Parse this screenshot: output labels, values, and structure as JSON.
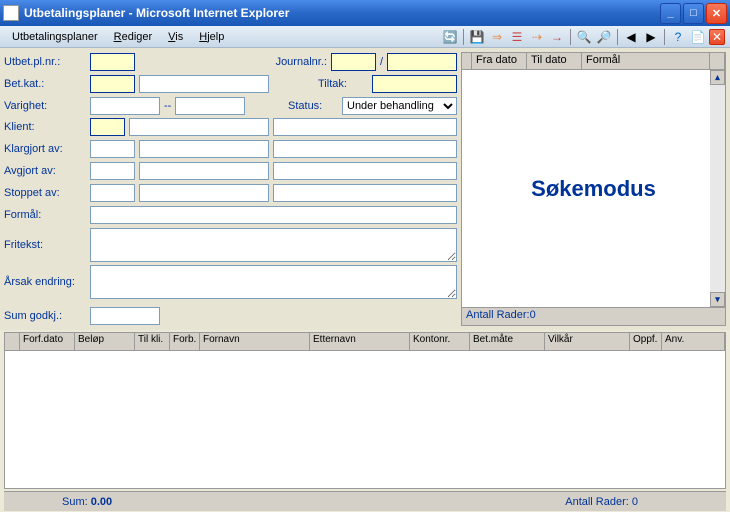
{
  "window": {
    "title": "Utbetalingsplaner - Microsoft Internet Explorer"
  },
  "menu": {
    "utbetalingsplaner": "Utbetalingsplaner",
    "rediger": "Rediger",
    "vis": "Vis",
    "hjelp": "Hjelp"
  },
  "form": {
    "utbetplnr": "Utbet.pl.nr.:",
    "journalnr": "Journalnr.:",
    "slash": "/",
    "betkat": "Bet.kat.:",
    "tiltak": "Tiltak:",
    "varighet": "Varighet:",
    "dash": "--",
    "status": "Status:",
    "status_value": "Under behandling",
    "klient": "Klient:",
    "klargjort": "Klargjort av:",
    "avgjort": "Avgjort av:",
    "stoppet": "Stoppet av:",
    "formal": "Formål:",
    "fritekst": "Fritekst:",
    "arsak": "Årsak endring:",
    "sumgodkj": "Sum godkj.:"
  },
  "rightpanel": {
    "fradato": "Fra dato",
    "tildato": "Til dato",
    "formal": "Formål",
    "body": "Søkemodus",
    "footer": "Antall Rader:0"
  },
  "grid": {
    "cols": [
      "",
      "Forf.dato",
      "Beløp",
      "Til kli.",
      "Forb.",
      "Fornavn",
      "Etternavn",
      "Kontonr.",
      "Bet.måte",
      "Vilkår",
      "Oppf.",
      "Anv."
    ]
  },
  "status": {
    "sum_label": "Sum: ",
    "sum_value": "0.00",
    "antall": "Antall Rader: 0"
  }
}
